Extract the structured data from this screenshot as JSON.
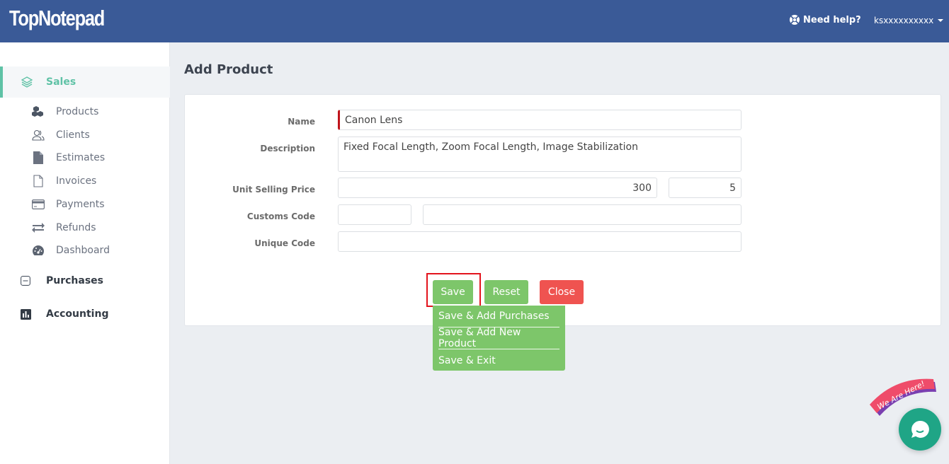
{
  "header": {
    "logo": "TopNotepad",
    "help_label": "Need help?",
    "user_label": "ksxxxxxxxxxx",
    "brand_color": "#3a5a97"
  },
  "sidebar": {
    "active_section": "Sales",
    "sales": {
      "label": "Sales",
      "icon": "layers-icon"
    },
    "sales_items": [
      {
        "label": "Products",
        "icon": "cubes-icon"
      },
      {
        "label": "Clients",
        "icon": "users-icon"
      },
      {
        "label": "Estimates",
        "icon": "file-filled-icon"
      },
      {
        "label": "Invoices",
        "icon": "file-outline-icon"
      },
      {
        "label": "Payments",
        "icon": "credit-card-icon"
      },
      {
        "label": "Refunds",
        "icon": "exchange-icon"
      },
      {
        "label": "Dashboard",
        "icon": "dashboard-gauge-icon"
      }
    ],
    "purchases": {
      "label": "Purchases",
      "icon": "minus-square-icon"
    },
    "accounting": {
      "label": "Accounting",
      "icon": "bar-chart-icon"
    }
  },
  "page": {
    "title": "Add Product"
  },
  "form": {
    "name": {
      "label": "Name",
      "value": "Canon Lens"
    },
    "description": {
      "label": "Description",
      "value": "Fixed Focal Length, Zoom Focal Length, Image Stabilization"
    },
    "unit_selling_price": {
      "label": "Unit Selling Price",
      "value": "300",
      "secondary_value": "5"
    },
    "customs_code": {
      "label": "Customs Code",
      "value": "",
      "secondary_value": ""
    },
    "unique_code": {
      "label": "Unique Code",
      "value": ""
    }
  },
  "actions": {
    "save": "Save",
    "reset": "Reset",
    "close": "Close",
    "save_menu": [
      "Save & Add Purchases",
      "Save & Add New Product",
      "Save & Exit"
    ]
  },
  "chat": {
    "banner": "We Are Here!"
  }
}
